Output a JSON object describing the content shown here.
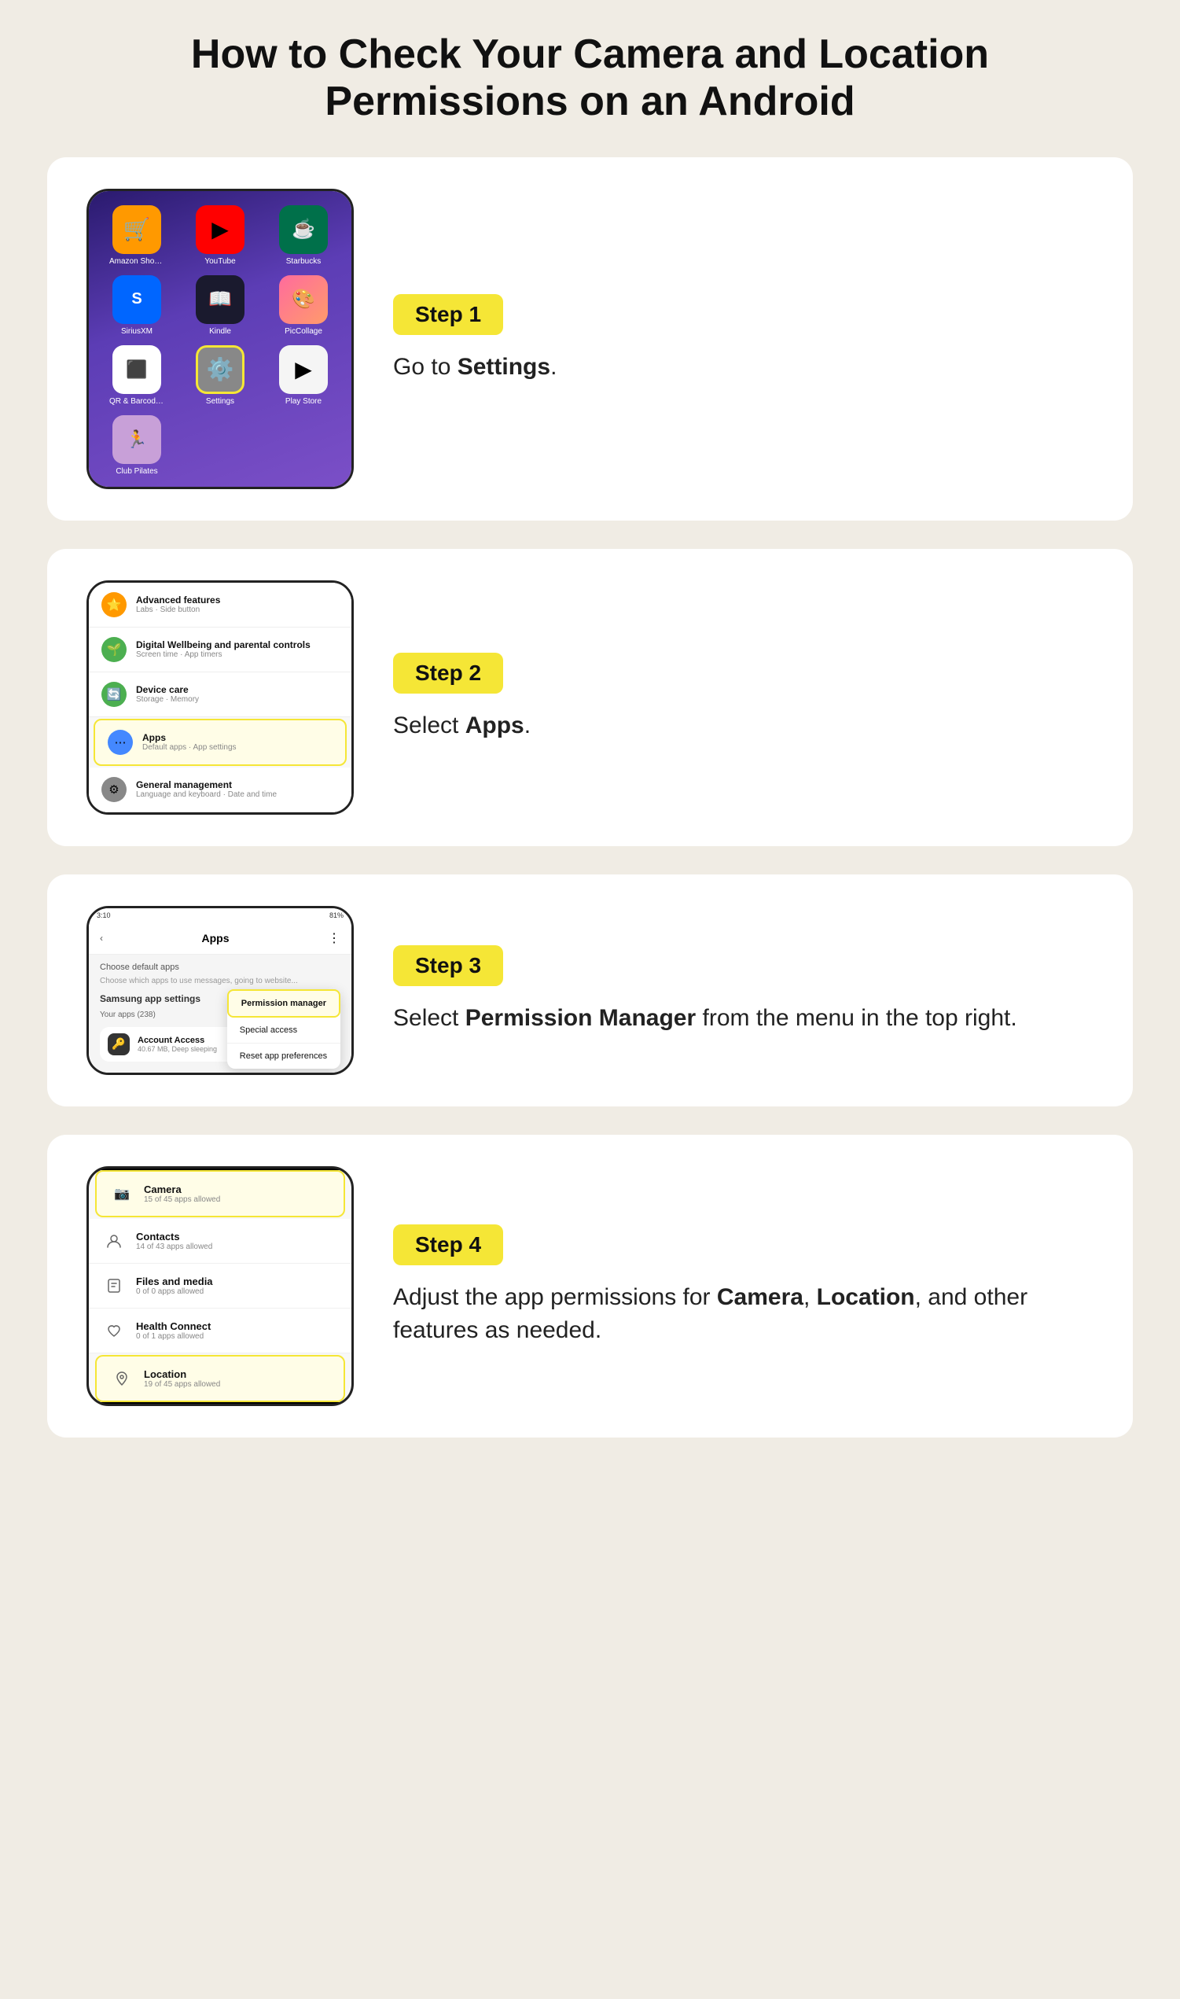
{
  "page": {
    "title": "How to Check Your Camera and Location Permissions on an Android",
    "background": "#f0ece4"
  },
  "steps": [
    {
      "badge": "Step 1",
      "text_before": "Go to ",
      "text_bold": "Settings",
      "text_after": ".",
      "has_after": true
    },
    {
      "badge": "Step 2",
      "text_before": "Select ",
      "text_bold": "Apps",
      "text_after": ".",
      "has_after": true
    },
    {
      "badge": "Step 3",
      "text_before": "Select ",
      "text_bold": "Permission Manager",
      "text_after": " from the menu in the top right.",
      "has_after": true
    },
    {
      "badge": "Step 4",
      "text_before": "Adjust the app permissions for ",
      "text_bold": "Camera",
      "text_middle": ", ",
      "text_bold2": "Location",
      "text_after": ", and other features as needed.",
      "has_after": true
    }
  ],
  "step1": {
    "apps": [
      {
        "label": "Amazon Shopping",
        "emoji": "🛒",
        "bg": "#ff9900",
        "highlighted": false
      },
      {
        "label": "YouTube",
        "emoji": "▶️",
        "bg": "#ff0000",
        "highlighted": false
      },
      {
        "label": "Starbucks",
        "emoji": "☕",
        "bg": "#00704a",
        "highlighted": false
      },
      {
        "label": "SiriusXM",
        "emoji": "📻",
        "bg": "#0066ff",
        "highlighted": false
      },
      {
        "label": "Kindle",
        "emoji": "📖",
        "bg": "#1a1a2e",
        "highlighted": false
      },
      {
        "label": "PicCollage",
        "emoji": "🎨",
        "bg": "#ff6b9d",
        "highlighted": false
      },
      {
        "label": "QR & Barcode Sc...",
        "emoji": "⬛",
        "bg": "#fff",
        "highlighted": false
      },
      {
        "label": "Settings",
        "emoji": "⚙️",
        "bg": "#888",
        "highlighted": true
      },
      {
        "label": "Play Store",
        "emoji": "▶",
        "bg": "#f5f5f5",
        "highlighted": false
      },
      {
        "label": "Club Pilates",
        "emoji": "🏃",
        "bg": "#c8a0d8",
        "highlighted": false
      }
    ]
  },
  "step2": {
    "items": [
      {
        "icon": "⭐",
        "icon_bg": "#ff9900",
        "title": "Advanced features",
        "sub": "Labs · Side button",
        "highlighted": false
      },
      {
        "icon": "🌱",
        "icon_bg": "#4caf50",
        "title": "Digital Wellbeing and parental controls",
        "sub": "Screen time · App timers",
        "highlighted": false
      },
      {
        "icon": "🌀",
        "icon_bg": "#4caf50",
        "title": "Device care",
        "sub": "Storage · Memory",
        "highlighted": false
      },
      {
        "icon": "⋯",
        "icon_bg": "#4488ff",
        "title": "Apps",
        "sub": "Default apps · App settings",
        "highlighted": true
      },
      {
        "icon": "⚙",
        "icon_bg": "#888",
        "title": "General management",
        "sub": "Language and keyboard · Date and time",
        "highlighted": false
      }
    ]
  },
  "step3": {
    "status_time": "3:10",
    "battery": "81%",
    "title": "Apps",
    "menu_items": [
      {
        "label": "Permission manager",
        "highlighted": true
      },
      {
        "label": "Special access",
        "highlighted": false
      },
      {
        "label": "Reset app preferences",
        "highlighted": false
      }
    ],
    "body_title": "Choose default apps",
    "body_sub": "Choose which apps to use messages, going to website...",
    "samsung_label": "Samsung app settings",
    "your_apps": "Your apps (238)",
    "list_item_title": "Account Access",
    "list_item_sub": "40.67 MB, Deep sleeping"
  },
  "step4": {
    "permissions": [
      {
        "icon": "📷",
        "title": "Camera",
        "sub": "15 of 45 apps allowed",
        "highlighted": true
      },
      {
        "icon": "👤",
        "title": "Contacts",
        "sub": "14 of 43 apps allowed",
        "highlighted": false
      },
      {
        "icon": "🗂️",
        "title": "Files and media",
        "sub": "0 of 0 apps allowed",
        "highlighted": false
      },
      {
        "icon": "❤️",
        "title": "Health Connect",
        "sub": "0 of 1 apps allowed",
        "highlighted": false
      },
      {
        "icon": "📍",
        "title": "Location",
        "sub": "19 of 45 apps allowed",
        "highlighted": true
      }
    ]
  }
}
